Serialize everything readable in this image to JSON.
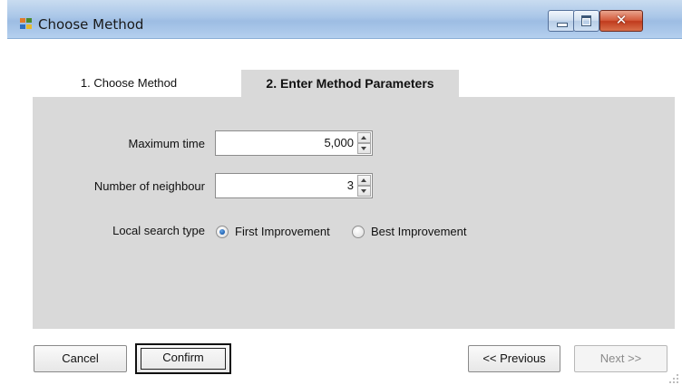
{
  "window": {
    "title": "Choose Method",
    "accent_color": "#a9c6e8"
  },
  "tabs": [
    {
      "label": "1. Choose Method",
      "selected": false
    },
    {
      "label": "2. Enter Method Parameters",
      "selected": true
    }
  ],
  "fields": {
    "maximum_time": {
      "label": "Maximum time",
      "value": "5,000"
    },
    "number_of_neighbour": {
      "label": "Number of neighbour",
      "value": "3"
    }
  },
  "local_search": {
    "label": "Local search type",
    "options": [
      {
        "label": "First Improvement",
        "checked": true
      },
      {
        "label": "Best Improvement",
        "checked": false
      }
    ]
  },
  "buttons": {
    "cancel": "Cancel",
    "confirm": "Confirm",
    "previous": "<< Previous",
    "next": "Next >>"
  },
  "icons": {
    "app": "window-app-icon",
    "minimize": "minimize-icon",
    "maximize": "maximize-icon",
    "close": "close-icon"
  }
}
